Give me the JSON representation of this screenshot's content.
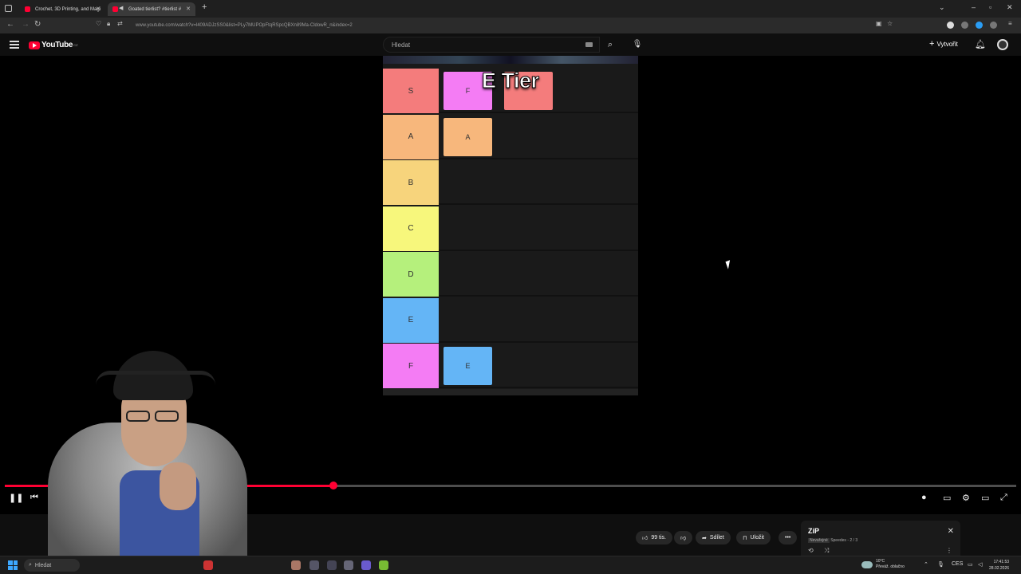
{
  "browser": {
    "tabs": [
      {
        "title": "Crochet, 3D Printing, and Magi",
        "active": false
      },
      {
        "title": "Goated tierlist? #tierlist #",
        "active": true
      }
    ],
    "url": "www.youtube.com/watch?v=l409ADJzSS0&list=PLy7MUPOpFtqRSpcQBXn89Ma-CldowR_n&index=2"
  },
  "youtube": {
    "logo_text": "YouTube",
    "country_code": "CZ",
    "search_placeholder": "Hledat",
    "create_label": "Vytvořit"
  },
  "video": {
    "overlay_text": "E Tier",
    "tiers": [
      {
        "label": "S",
        "color": "#f47c7c",
        "items": [
          {
            "label": "F",
            "color": "#f47cf4"
          },
          {
            "label": "",
            "color": "#f47c7c"
          }
        ]
      },
      {
        "label": "A",
        "color": "#f7b77c",
        "items": [
          {
            "label": "A",
            "color": "#f7b77c"
          }
        ]
      },
      {
        "label": "B",
        "color": "#f7d47c",
        "items": []
      },
      {
        "label": "C",
        "color": "#f7f77c",
        "items": []
      },
      {
        "label": "D",
        "color": "#b5f07c",
        "items": []
      },
      {
        "label": "E",
        "color": "#64b5f6",
        "items": []
      },
      {
        "label": "F",
        "color": "#f47cf4",
        "items": [
          {
            "label": "E",
            "color": "#64b5f6"
          }
        ]
      }
    ],
    "progress_fraction": 0.325
  },
  "actions": {
    "likes": "99 tis.",
    "share": "Sdílet",
    "save": "Uložit"
  },
  "queue": {
    "title": "ZiP",
    "badge": "Nevařejné",
    "subtitle": "Speedes - 2 / 3"
  },
  "taskbar": {
    "search": "Hledat",
    "weather_temp": "10°C",
    "weather_desc": "Převáž. oblačno",
    "lang": "CES",
    "time": "17:41:53",
    "date": "28.02.2026"
  }
}
